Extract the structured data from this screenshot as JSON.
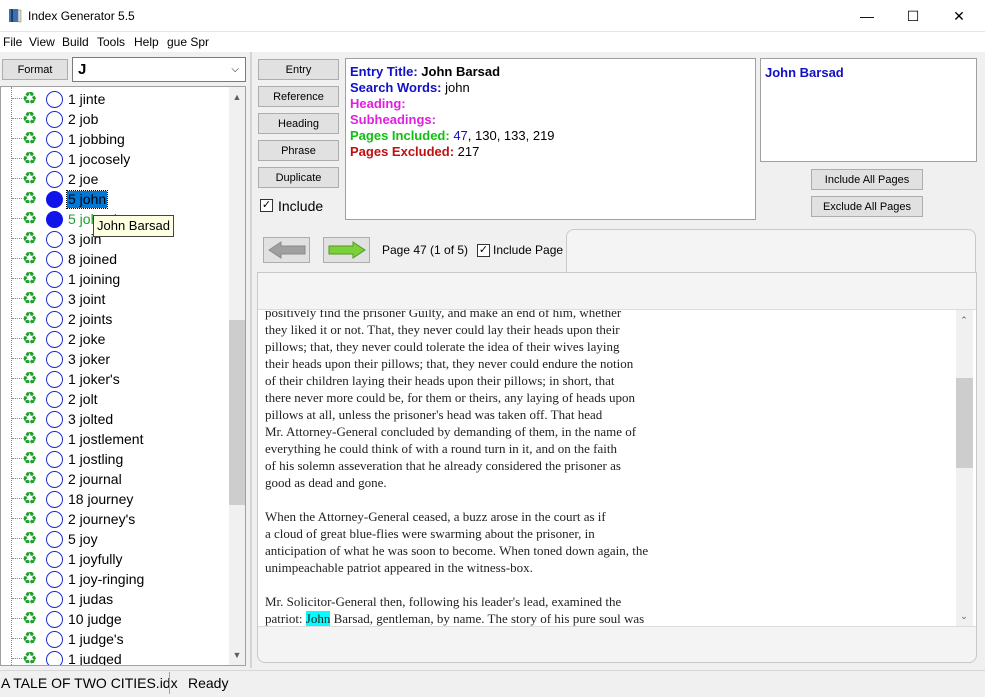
{
  "window": {
    "title": "Index Generator 5.5",
    "minimize_glyph": "—",
    "maximize_glyph": "☐",
    "close_glyph": "✕"
  },
  "menu": [
    "File",
    "View",
    "Build",
    "Tools",
    "Help",
    "gue Spr"
  ],
  "left_panel": {
    "format_label": "Format",
    "letter_value": "J",
    "rows": [
      {
        "count": "1",
        "word": "jinte",
        "circle": "empty",
        "state": "normal"
      },
      {
        "count": "2",
        "word": "job",
        "circle": "empty",
        "state": "normal"
      },
      {
        "count": "1",
        "word": "jobbing",
        "circle": "empty",
        "state": "normal"
      },
      {
        "count": "1",
        "word": "jocosely",
        "circle": "empty",
        "state": "normal"
      },
      {
        "count": "2",
        "word": "joe",
        "circle": "empty",
        "state": "normal"
      },
      {
        "count": "5",
        "word": "john",
        "circle": "filled",
        "state": "selected"
      },
      {
        "count": "5",
        "word": "johnnie",
        "circle": "filled",
        "state": "green"
      },
      {
        "count": "3",
        "word": "join",
        "circle": "empty",
        "state": "normal"
      },
      {
        "count": "8",
        "word": "joined",
        "circle": "empty",
        "state": "normal"
      },
      {
        "count": "1",
        "word": "joining",
        "circle": "empty",
        "state": "normal"
      },
      {
        "count": "3",
        "word": "joint",
        "circle": "empty",
        "state": "normal"
      },
      {
        "count": "2",
        "word": "joints",
        "circle": "empty",
        "state": "normal"
      },
      {
        "count": "2",
        "word": "joke",
        "circle": "empty",
        "state": "normal"
      },
      {
        "count": "3",
        "word": "joker",
        "circle": "empty",
        "state": "normal"
      },
      {
        "count": "1",
        "word": "joker's",
        "circle": "empty",
        "state": "normal"
      },
      {
        "count": "2",
        "word": "jolt",
        "circle": "empty",
        "state": "normal"
      },
      {
        "count": "3",
        "word": "jolted",
        "circle": "empty",
        "state": "normal"
      },
      {
        "count": "1",
        "word": "jostlement",
        "circle": "empty",
        "state": "normal"
      },
      {
        "count": "1",
        "word": "jostling",
        "circle": "empty",
        "state": "normal"
      },
      {
        "count": "2",
        "word": "journal",
        "circle": "empty",
        "state": "normal"
      },
      {
        "count": "18",
        "word": "journey",
        "circle": "empty",
        "state": "normal"
      },
      {
        "count": "2",
        "word": "journey's",
        "circle": "empty",
        "state": "normal"
      },
      {
        "count": "5",
        "word": "joy",
        "circle": "empty",
        "state": "normal"
      },
      {
        "count": "1",
        "word": "joyfully",
        "circle": "empty",
        "state": "normal"
      },
      {
        "count": "1",
        "word": "joy-ringing",
        "circle": "empty",
        "state": "normal"
      },
      {
        "count": "1",
        "word": "judas",
        "circle": "empty",
        "state": "normal"
      },
      {
        "count": "10",
        "word": "judge",
        "circle": "empty",
        "state": "normal"
      },
      {
        "count": "1",
        "word": "judge's",
        "circle": "empty",
        "state": "normal"
      },
      {
        "count": "1",
        "word": "judged",
        "circle": "empty",
        "state": "normal"
      }
    ],
    "tooltip": "John Barsad"
  },
  "buttons": {
    "entry": "Entry",
    "reference": "Reference",
    "heading": "Heading",
    "phrase": "Phrase",
    "duplicate": "Duplicate",
    "include": "Include",
    "include_all_pages": "Include All Pages",
    "exclude_all_pages": "Exclude All Pages"
  },
  "entry": {
    "title_label": "Entry Title:",
    "title_value": "John Barsad",
    "search_label": "Search Words:",
    "search_value": "john",
    "heading_label": "Heading:",
    "subheadings_label": "Subheadings:",
    "pages_included_label": "Pages Included:",
    "pages_included_first": "47",
    "pages_included_rest": ", 130, 133, 219",
    "pages_excluded_label": "Pages Excluded:",
    "pages_excluded_value": "217"
  },
  "title_box": "John Barsad",
  "nav": {
    "page_label": "Page 47 (1 of 5)",
    "include_page_label": "Include Page",
    "include_page_checked": true,
    "include_checked": true
  },
  "text": {
    "lines": [
      "positively find the prisoner Guilty, and make an end of him, whether",
      "they liked it or not. That, they never could lay their heads upon their",
      "pillows; that, they never could tolerate the idea of their wives laying",
      "their heads upon their pillows; that, they never could endure the notion",
      "of their children laying their heads upon their pillows; in short, that",
      "there never more could be, for them or theirs, any laying of heads upon",
      "pillows at all, unless the prisoner's head was taken off. That head",
      "Mr. Attorney-General concluded by demanding of them, in the name of",
      "everything he could think of with a round turn in it, and on the faith",
      "of his solemn asseveration that he already considered the prisoner as",
      "good as dead and gone.",
      "",
      "When the Attorney-General ceased, a buzz arose in the court as if",
      "a cloud of great blue-flies were swarming about the prisoner, in",
      "anticipation of what he was soon to become. When toned down again, the",
      "unimpeachable patriot appeared in the witness-box.",
      "",
      "Mr. Solicitor-General then, following his leader's lead, examined the"
    ],
    "last_line_prefix": "patriot: ",
    "last_line_highlight": "John",
    "last_line_suffix": " Barsad, gentleman, by name. The story of his pure soul was"
  },
  "status": {
    "file": "A TALE OF TWO CITIES.idx",
    "state": "Ready"
  },
  "colors": {
    "label_blue": "#1010c8",
    "label_magenta": "#e020e0",
    "label_green": "#10c010",
    "label_red": "#c01010",
    "page_link_blue": "#1010c8",
    "highlight": "#00ffff",
    "selection": "#0078d7"
  }
}
